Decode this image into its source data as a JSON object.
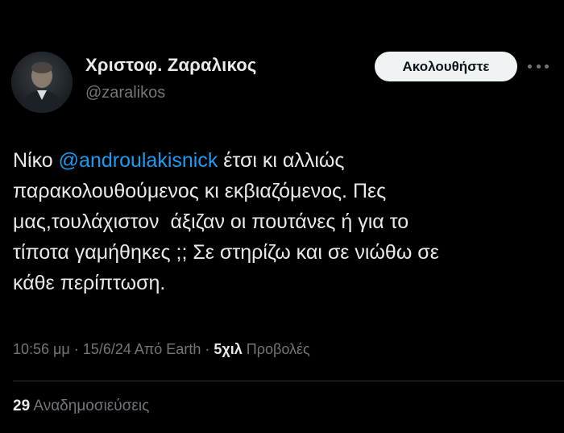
{
  "author": {
    "display_name": "Χριστοφ. Ζαραλικος",
    "handle": "@zaralikos"
  },
  "follow_button": {
    "label": "Ακολουθήστε"
  },
  "more_icon": "more-horizontal-icon",
  "tweet": {
    "text_before": "Νίκο ",
    "mention": "@androulakisnick",
    "text_after": " έτσι κι αλλιώς\nπαρακολουθούμενος κι εκβιαζόμενος. Πες\nμας,τουλάχιστον  άξιζαν οι πουτάνες ή για το\nτίποτα γαμήθηκες ;; Σε στηρίζω και σε νιώθω σε\nκάθε περίπτωση."
  },
  "meta": {
    "time": "10:56 μμ",
    "separator1": " · ",
    "date": "15/6/24",
    "source": " Από Earth",
    "separator2": " · ",
    "views_count": "5χιλ",
    "views_label": " Προβολές"
  },
  "stats": {
    "reposts_count": "29",
    "reposts_label": " Αναδημοσιεύσεις"
  },
  "colors": {
    "background": "#000000",
    "primary_text": "#e7e9ea",
    "secondary_text": "#71767b",
    "link": "#1d9bf0",
    "button_bg": "#eff3f4",
    "divider": "#2f3336"
  }
}
